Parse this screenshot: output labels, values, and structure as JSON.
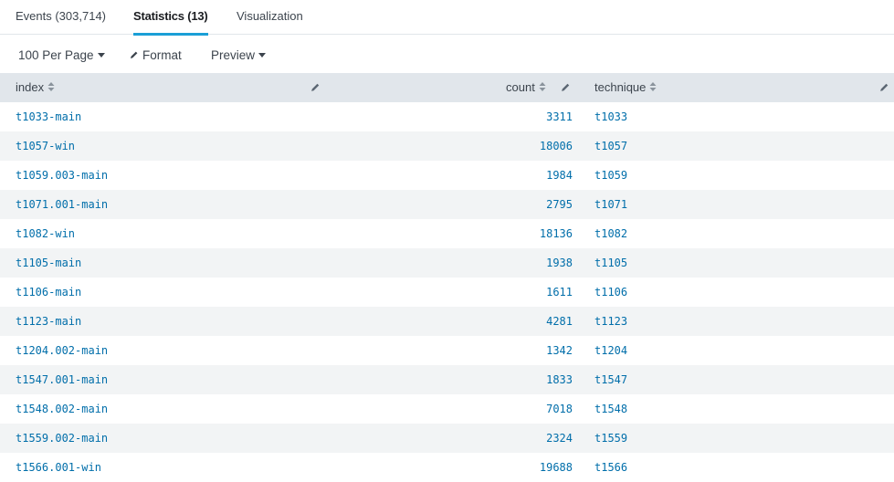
{
  "tabs": [
    {
      "label": "Events (303,714)"
    },
    {
      "label": "Statistics (13)"
    },
    {
      "label": "Visualization"
    }
  ],
  "toolbar": {
    "per_page": "100 Per Page",
    "format": "Format",
    "preview": "Preview"
  },
  "columns": [
    {
      "label": "index"
    },
    {
      "label": "count"
    },
    {
      "label": "technique"
    }
  ],
  "rows": [
    {
      "index": "t1033-main",
      "count": "3311",
      "technique": "t1033"
    },
    {
      "index": "t1057-win",
      "count": "18006",
      "technique": "t1057"
    },
    {
      "index": "t1059.003-main",
      "count": "1984",
      "technique": "t1059"
    },
    {
      "index": "t1071.001-main",
      "count": "2795",
      "technique": "t1071"
    },
    {
      "index": "t1082-win",
      "count": "18136",
      "technique": "t1082"
    },
    {
      "index": "t1105-main",
      "count": "1938",
      "technique": "t1105"
    },
    {
      "index": "t1106-main",
      "count": "1611",
      "technique": "t1106"
    },
    {
      "index": "t1123-main",
      "count": "4281",
      "technique": "t1123"
    },
    {
      "index": "t1204.002-main",
      "count": "1342",
      "technique": "t1204"
    },
    {
      "index": "t1547.001-main",
      "count": "1833",
      "technique": "t1547"
    },
    {
      "index": "t1548.002-main",
      "count": "7018",
      "technique": "t1548"
    },
    {
      "index": "t1559.002-main",
      "count": "2324",
      "technique": "t1559"
    },
    {
      "index": "t1566.001-win",
      "count": "19688",
      "technique": "t1566"
    }
  ],
  "icons": {
    "sort": "sort-icon",
    "edit": "pencil-icon",
    "dropdown": "caret-down-icon"
  },
  "colors": {
    "link": "#006eaa",
    "active_tab_underline": "#1a9fd6",
    "header_bg": "#e1e6eb",
    "stripe_bg": "#f2f4f5"
  }
}
